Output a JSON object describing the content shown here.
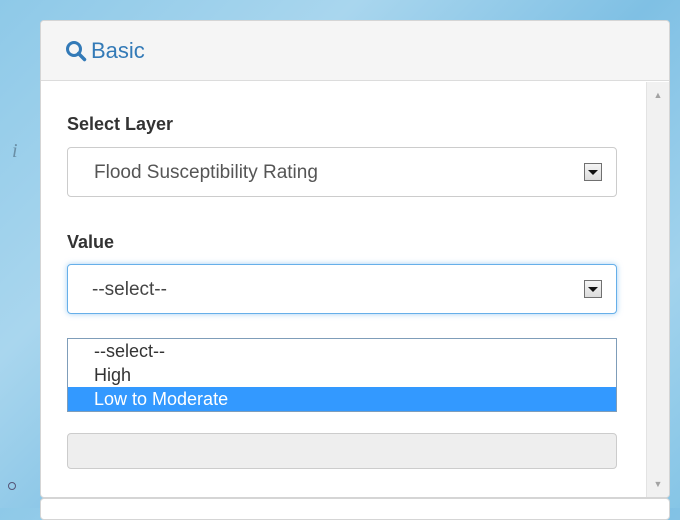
{
  "panel": {
    "title": "Basic",
    "icon": "search-icon",
    "accent_color": "#337ab7"
  },
  "layer_field": {
    "label": "Select Layer",
    "selected": "Flood Susceptibility Rating"
  },
  "value_field": {
    "label": "Value",
    "selected": "--select--",
    "options": [
      "--select--",
      "High",
      "Low to Moderate"
    ],
    "highlighted": "Low to Moderate",
    "highlight_color": "#3399ff"
  },
  "map": {
    "glyph": "i"
  }
}
